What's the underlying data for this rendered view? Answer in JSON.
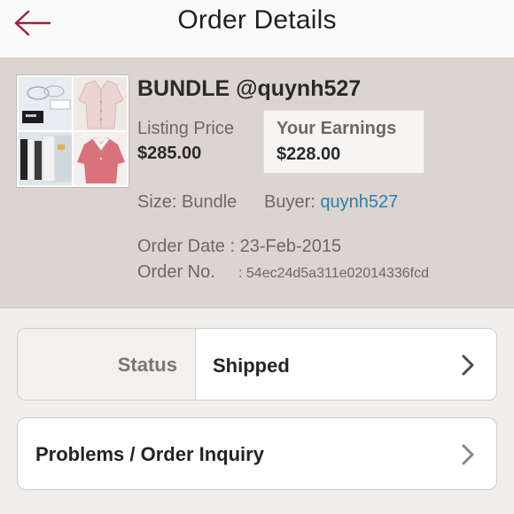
{
  "header": {
    "title": "Order Details",
    "back_icon": "back-arrow-icon",
    "accent": "#9b2335"
  },
  "listing": {
    "title": "BUNDLE @quynh527",
    "price_label": "Listing Price",
    "price_value": "$285.00",
    "earnings_label": "Your Earnings",
    "earnings_value": "$228.00",
    "size_text": "Size: Bundle",
    "buyer_label": "Buyer:",
    "buyer_name": "quynh527",
    "order_date_text": "Order Date : 23-Feb-2015",
    "order_no_label": "Order No.",
    "order_no_value": ": 54ec24d5a311e02014336fcd"
  },
  "status": {
    "label": "Status",
    "value": "Shipped"
  },
  "inquiry": {
    "label": "Problems / Order Inquiry"
  },
  "colors": {
    "link": "#2a7fb0",
    "summary_bg": "#dcd4cf"
  }
}
